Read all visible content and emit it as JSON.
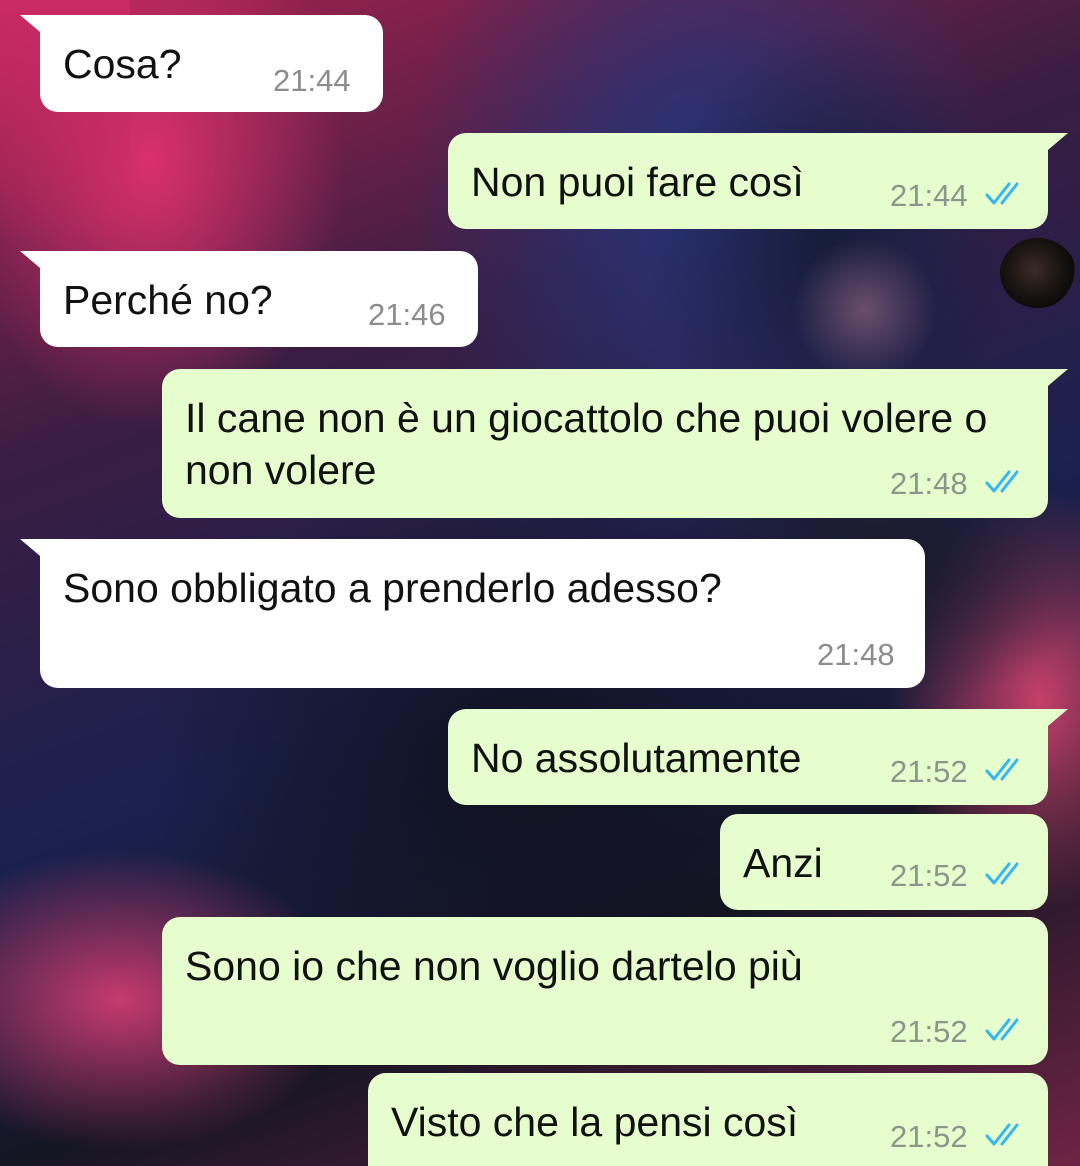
{
  "messages": [
    {
      "dir": "in",
      "text": "Cosa?",
      "time": "21:44"
    },
    {
      "dir": "out",
      "text": "Non puoi fare così",
      "time": "21:44",
      "status": "read-ticks-icon"
    },
    {
      "dir": "in",
      "text": "Perché no?",
      "time": "21:46"
    },
    {
      "dir": "out",
      "text": "Il cane non è un giocattolo che puoi volere o non volere",
      "time": "21:48",
      "status": "read-ticks-icon"
    },
    {
      "dir": "in",
      "text": "Sono obbligato a prenderlo adesso?",
      "time": "21:48"
    },
    {
      "dir": "out",
      "text": "No assolutamente",
      "time": "21:52",
      "status": "read-ticks-icon"
    },
    {
      "dir": "out",
      "text": "Anzi",
      "time": "21:52",
      "status": "read-ticks-icon"
    },
    {
      "dir": "out",
      "text": "Sono io che non voglio dartelo più",
      "time": "21:52",
      "status": "read-ticks-icon"
    },
    {
      "dir": "out",
      "text": "Visto che la pensi così",
      "time": "21:52",
      "status": "read-ticks-icon"
    }
  ],
  "colors": {
    "incoming_bubble": "#ffffff",
    "outgoing_bubble": "#e6fecd",
    "read_ticks": "#34b7f1",
    "timestamp": "#8c8c8c"
  }
}
